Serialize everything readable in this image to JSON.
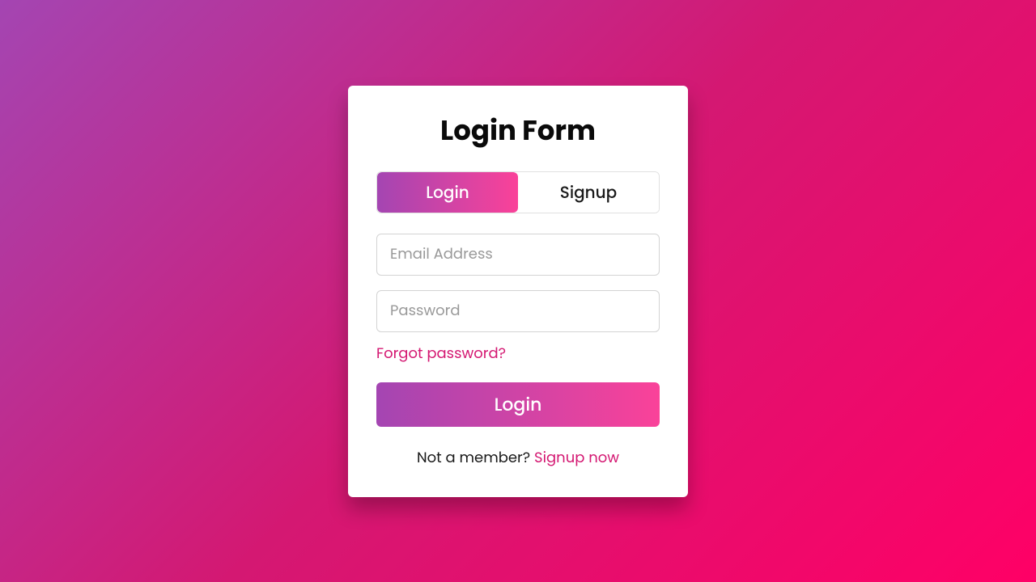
{
  "title": "Login Form",
  "tabs": {
    "login": "Login",
    "signup": "Signup"
  },
  "fields": {
    "email": {
      "placeholder": "Email Address",
      "value": ""
    },
    "password": {
      "placeholder": "Password",
      "value": ""
    }
  },
  "forgot_link": "Forgot password?",
  "submit_label": "Login",
  "footer": {
    "text": "Not a member? ",
    "link": "Signup now"
  },
  "colors": {
    "gradient_start": "#a445b2",
    "gradient_end": "#fa4299",
    "accent": "#d41872"
  }
}
